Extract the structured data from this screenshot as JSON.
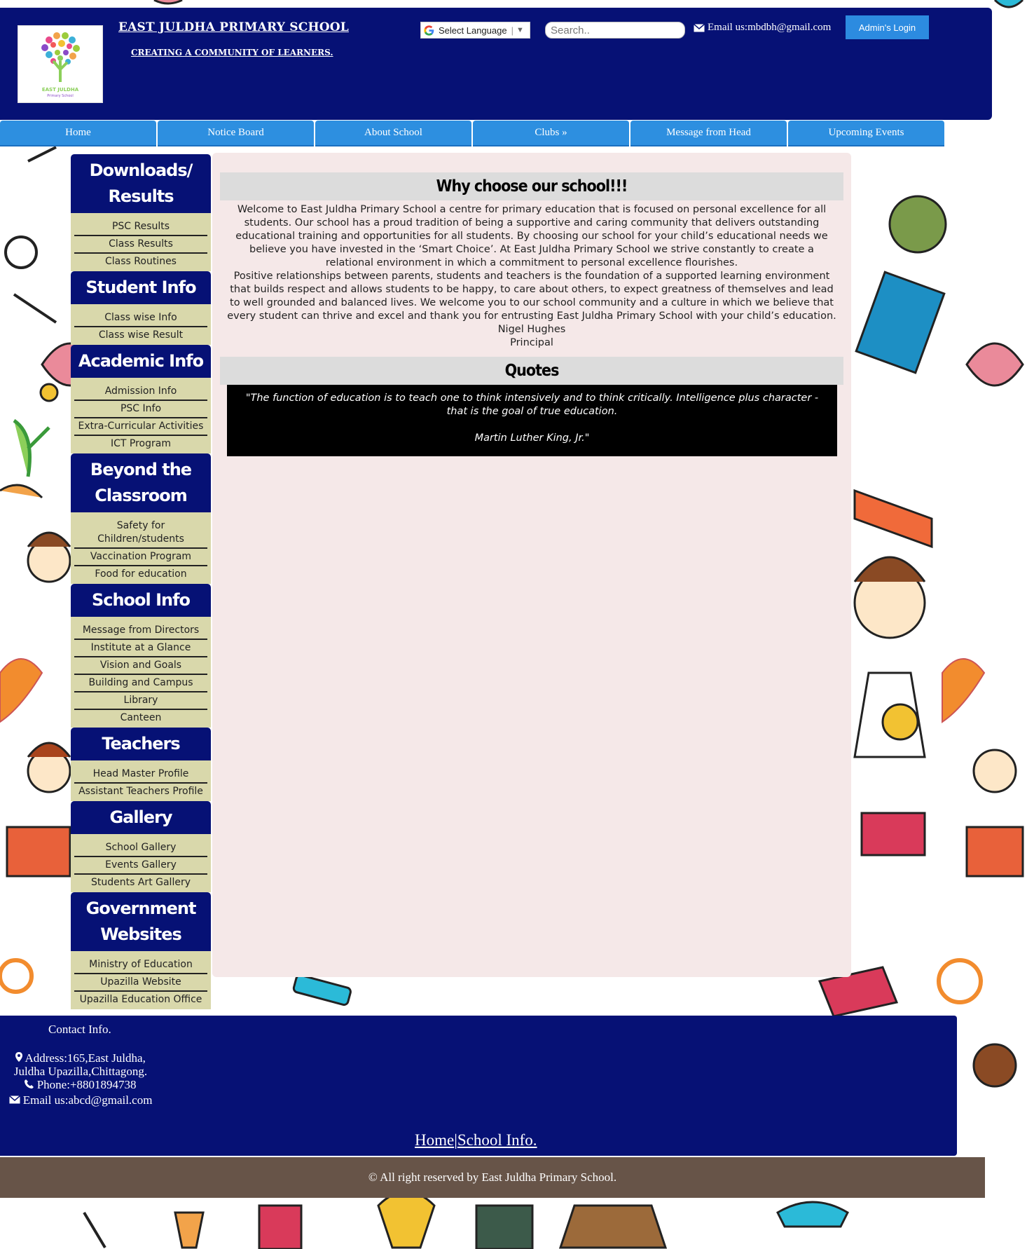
{
  "header": {
    "school_name": "EAST JULDHA PRIMARY SCHOOL",
    "tagline": "CREATING A COMMUNITY OF LEARNERS.",
    "logo_text_line1": "EAST JULDHA",
    "logo_text_line2": "Primary School",
    "language_label": "Select Language",
    "search_placeholder": "Search..",
    "email_text": "Email us:mbdbh@gmail.com",
    "admin_button": "Admin's Login"
  },
  "topnav": {
    "items": [
      "Home",
      "Notice Board",
      "About School",
      "Clubs »",
      "Message from Head",
      "Upcoming Events"
    ]
  },
  "sidebar": {
    "sections": [
      {
        "title": "Downloads/ Results",
        "links": [
          "PSC Results",
          "Class Results",
          "Class Routines"
        ]
      },
      {
        "title": "Student Info",
        "links": [
          "Class wise Info",
          "Class wise Result"
        ]
      },
      {
        "title": "Academic Info",
        "links": [
          "Admission Info",
          "PSC Info",
          "Extra-Curricular Activities",
          "ICT Program"
        ]
      },
      {
        "title": "Beyond the Classroom",
        "links": [
          "Safety for Children/students",
          "Vaccination Program",
          "Food for education"
        ]
      },
      {
        "title": "School Info",
        "links": [
          "Message from Directors",
          "Institute at a Glance",
          "Vision and Goals",
          "Building and Campus",
          "Library",
          "Canteen"
        ]
      },
      {
        "title": "Teachers",
        "links": [
          "Head Master Profile",
          "Assistant Teachers Profile"
        ]
      },
      {
        "title": "Gallery",
        "links": [
          "School Gallery",
          "Events Gallery",
          "Students Art Gallery"
        ]
      },
      {
        "title": "Government Websites",
        "links": [
          "Ministry of Education",
          "Upazilla Website",
          "Upazilla Education Office"
        ]
      }
    ]
  },
  "main": {
    "why_title": "Why choose our school!!!",
    "welcome_paragraph_1": "Welcome to East Juldha Primary School a centre for primary education that is focused on personal excellence for all students. Our school has a proud tradition of being a supportive and caring community that delivers outstanding educational training and opportunities for all students. By choosing our school for your child’s educational needs we believe you have invested in the ‘Smart Choice’. At East Juldha Primary School we strive constantly to create a relational environment in which a commitment to personal excellence flourishes.",
    "welcome_paragraph_2": "Positive relationships between parents, students and teachers is the foundation of a supported learning environment that builds respect and allows students to be happy, to care about others, to expect greatness of themselves and lead to well grounded and balanced lives. We welcome you to our school community and a culture in which we believe that every student can thrive and excel and thank you for entrusting East Juldha Primary School with your child’s education.",
    "signature_name": "Nigel Hughes",
    "signature_role": "Principal",
    "quotes_title": "Quotes",
    "quote_text": "\"The function of education is to teach one to think intensively and to think critically. Intelligence plus character - that is the goal of true education.",
    "quote_author": "Martin Luther King, Jr.\""
  },
  "footer": {
    "contact_title": "Contact Info.",
    "address_line1": "Address:165,East Juldha,",
    "address_line2": "Juldha Upazilla,Chittagong.",
    "phone": "Phone:+8801894738",
    "email": "Email us:abcd@gmail.com",
    "link_home": "Home",
    "link_separator": "|",
    "link_school_info": "School Info.",
    "copyright": "© All right reserved by East Juldha Primary School."
  },
  "colors": {
    "header_bg": "#061175",
    "nav_bg": "#2d8fe0",
    "sidebar_list_bg": "#d9d8ab",
    "main_bg": "#f5e8e8",
    "copyright_bg": "#675448"
  }
}
